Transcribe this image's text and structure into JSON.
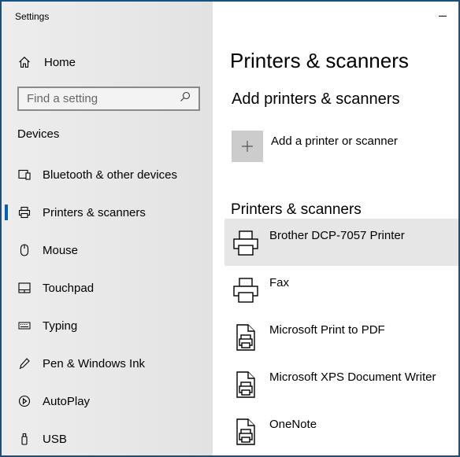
{
  "window": {
    "title": "Settings"
  },
  "sidebar": {
    "home_label": "Home",
    "search_placeholder": "Find a setting",
    "section_heading": "Devices",
    "items": [
      {
        "label": "Bluetooth & other devices",
        "icon": "bluetooth-devices-icon",
        "active": false
      },
      {
        "label": "Printers & scanners",
        "icon": "printer-icon",
        "active": true
      },
      {
        "label": "Mouse",
        "icon": "mouse-icon",
        "active": false
      },
      {
        "label": "Touchpad",
        "icon": "touchpad-icon",
        "active": false
      },
      {
        "label": "Typing",
        "icon": "keyboard-icon",
        "active": false
      },
      {
        "label": "Pen & Windows Ink",
        "icon": "pen-icon",
        "active": false
      },
      {
        "label": "AutoPlay",
        "icon": "autoplay-icon",
        "active": false
      },
      {
        "label": "USB",
        "icon": "usb-icon",
        "active": false
      }
    ]
  },
  "main": {
    "title": "Printers & scanners",
    "add_section_title": "Add printers & scanners",
    "add_button_label": "Add a printer or scanner",
    "list_heading": "Printers & scanners",
    "printers": [
      {
        "name": "Brother DCP-7057 Printer",
        "icon": "printer-icon",
        "selected": true
      },
      {
        "name": "Fax",
        "icon": "printer-icon",
        "selected": false
      },
      {
        "name": "Microsoft Print to PDF",
        "icon": "document-printer-icon",
        "selected": false
      },
      {
        "name": "Microsoft XPS Document Writer",
        "icon": "document-printer-icon",
        "selected": false
      },
      {
        "name": "OneNote",
        "icon": "document-printer-icon",
        "selected": false
      }
    ]
  },
  "colors": {
    "accent": "#0063b1",
    "sidebar_bg": "#e8e8e8",
    "selected_bg": "#e6e6e6",
    "frame": "#1f4e79"
  }
}
